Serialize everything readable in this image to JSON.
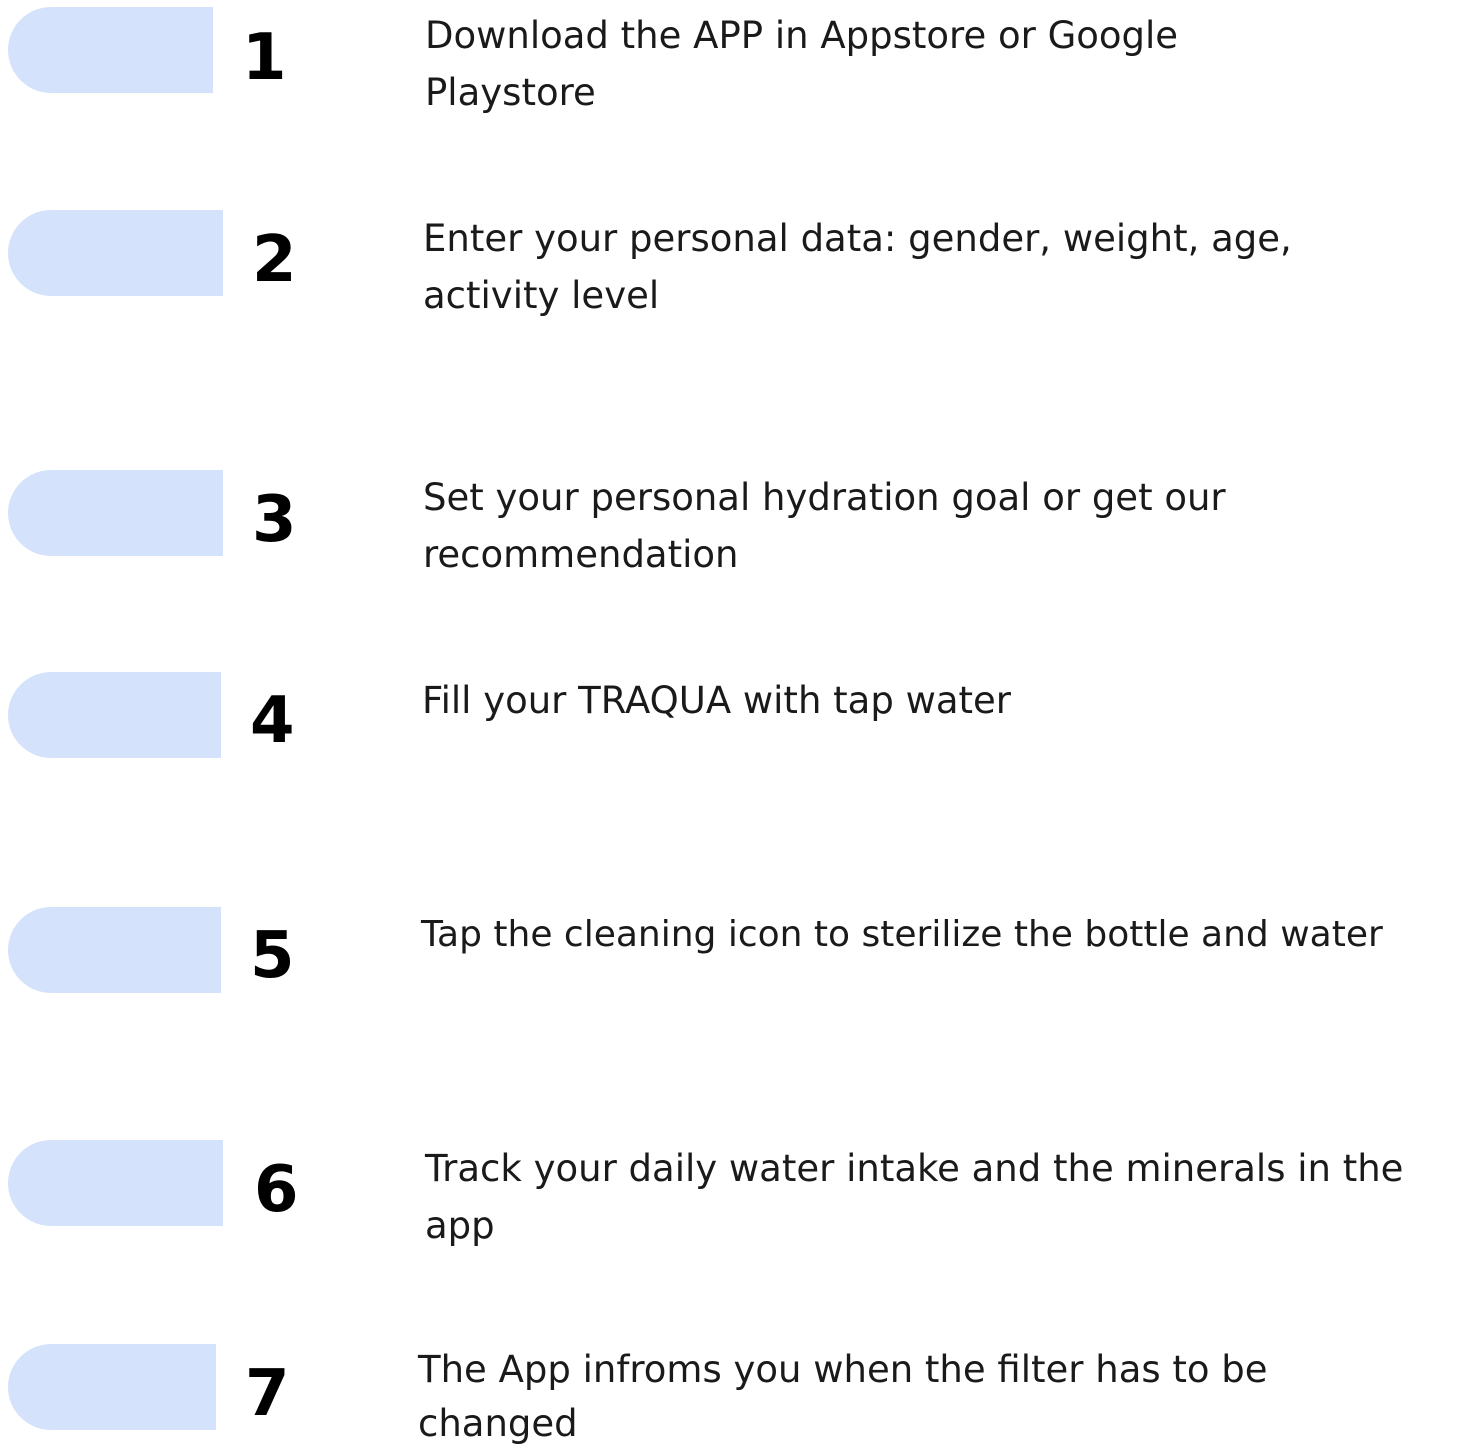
{
  "colors": {
    "pill": "#d4e2fb",
    "number": "#000000",
    "text": "#1a1a1a"
  },
  "steps": [
    {
      "number": "1",
      "text": "Download the APP in Appstore or Google Playstore"
    },
    {
      "number": "2",
      "text": "Enter your personal data: gender, weight, age, activity level"
    },
    {
      "number": "3",
      "text": "Set your personal hydration goal or get our recommendation"
    },
    {
      "number": "4",
      "text": "Fill your TRAQUA with tap water"
    },
    {
      "number": "5",
      "text": "Tap the cleaning icon to sterilize the bottle and water"
    },
    {
      "number": "6",
      "text": "Track your daily water intake and the minerals in the app"
    },
    {
      "number": "7",
      "text": "The App infroms you when the filter has to be changed"
    }
  ]
}
